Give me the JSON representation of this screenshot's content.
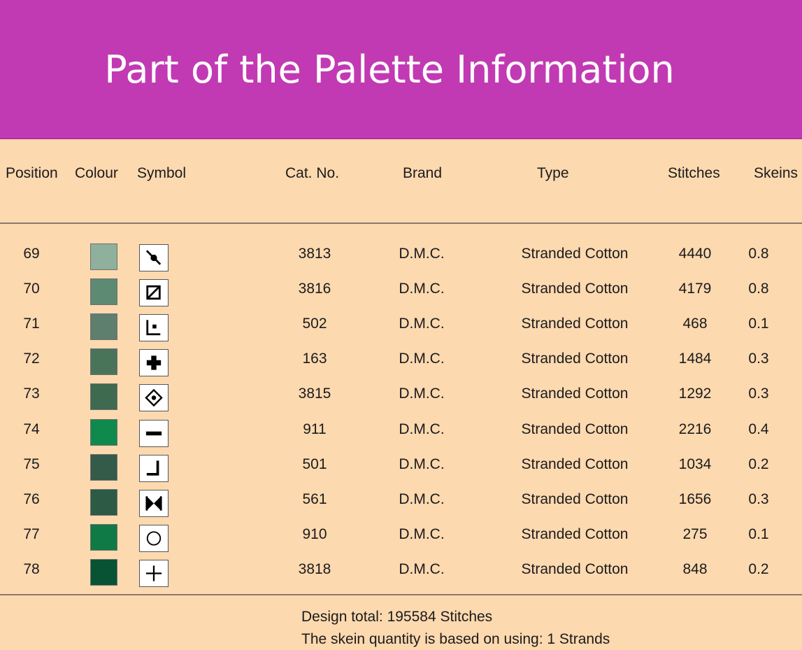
{
  "slide": {
    "title": "Part of the Palette Information"
  },
  "table": {
    "columns": [
      "Position",
      "Colour",
      "Symbol",
      "Cat. No.",
      "Brand",
      "Type",
      "Stitches",
      "Skeins"
    ],
    "rows": [
      {
        "position": "69",
        "colour": "#8fb09d",
        "symbol": "diagonal-dot-icon",
        "cat_no": "3813",
        "brand": "D.M.C.",
        "type": "Stranded Cotton",
        "stitches": "4440",
        "skeins": "0.8"
      },
      {
        "position": "70",
        "colour": "#5d8a73",
        "symbol": "slashed-square-icon",
        "cat_no": "3816",
        "brand": "D.M.C.",
        "type": "Stranded Cotton",
        "stitches": "4179",
        "skeins": "0.8"
      },
      {
        "position": "71",
        "colour": "#5e7f6d",
        "symbol": "corner-dot-icon",
        "cat_no": "502",
        "brand": "D.M.C.",
        "type": "Stranded Cotton",
        "stitches": "468",
        "skeins": "0.1"
      },
      {
        "position": "72",
        "colour": "#4a7459",
        "symbol": "bold-cross-icon",
        "cat_no": "163",
        "brand": "D.M.C.",
        "type": "Stranded Cotton",
        "stitches": "1484",
        "skeins": "0.3"
      },
      {
        "position": "73",
        "colour": "#3e6a50",
        "symbol": "diamond-dot-icon",
        "cat_no": "3815",
        "brand": "D.M.C.",
        "type": "Stranded Cotton",
        "stitches": "1292",
        "skeins": "0.3"
      },
      {
        "position": "74",
        "colour": "#0f8a4c",
        "symbol": "minus-bar-icon",
        "cat_no": "911",
        "brand": "D.M.C.",
        "type": "Stranded Cotton",
        "stitches": "2216",
        "skeins": "0.4"
      },
      {
        "position": "75",
        "colour": "#345a4a",
        "symbol": "corner-bracket-icon",
        "cat_no": "501",
        "brand": "D.M.C.",
        "type": "Stranded Cotton",
        "stitches": "1034",
        "skeins": "0.2"
      },
      {
        "position": "76",
        "colour": "#2c5a45",
        "symbol": "bowtie-icon",
        "cat_no": "561",
        "brand": "D.M.C.",
        "type": "Stranded Cotton",
        "stitches": "1656",
        "skeins": "0.3"
      },
      {
        "position": "77",
        "colour": "#0f7a45",
        "symbol": "circle-icon",
        "cat_no": "910",
        "brand": "D.M.C.",
        "type": "Stranded Cotton",
        "stitches": "275",
        "skeins": "0.1"
      },
      {
        "position": "78",
        "colour": "#075333",
        "symbol": "plus-icon",
        "cat_no": "3818",
        "brand": "D.M.C.",
        "type": "Stranded Cotton",
        "stitches": "848",
        "skeins": "0.2"
      }
    ],
    "footer": {
      "design_total": "Design total: 195584 Stitches",
      "skein_note": "The skein quantity is based on using: 1 Strands"
    }
  },
  "colors": {
    "banner": "#c13ab3",
    "panel": "#fdd9b0",
    "title_text": "#ffffff"
  }
}
